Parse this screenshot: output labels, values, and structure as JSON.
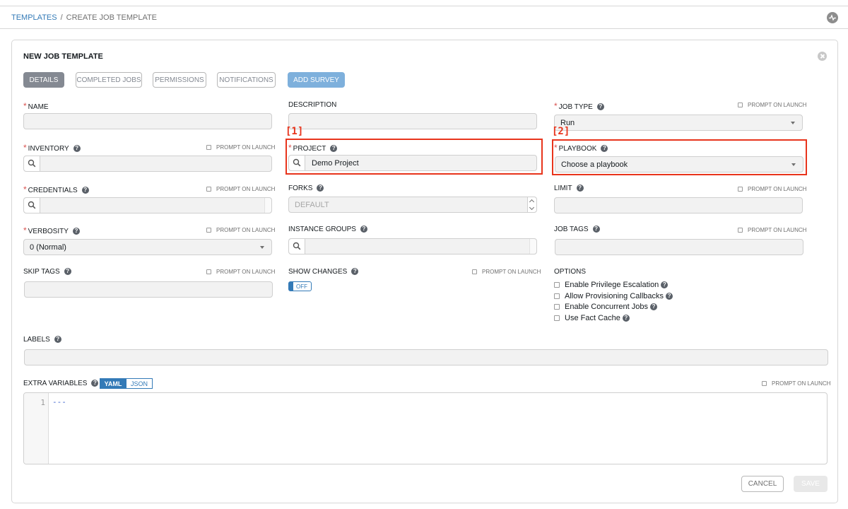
{
  "breadcrumb": {
    "parent": "TEMPLATES",
    "separator": "/",
    "current": "CREATE JOB TEMPLATE"
  },
  "panel": {
    "title": "NEW JOB TEMPLATE"
  },
  "tabs": [
    {
      "label": "DETAILS",
      "active": true
    },
    {
      "label": "COMPLETED JOBS",
      "active": false
    },
    {
      "label": "PERMISSIONS",
      "active": false
    },
    {
      "label": "NOTIFICATIONS",
      "active": false
    },
    {
      "label": "ADD SURVEY",
      "active": false
    }
  ],
  "common": {
    "prompt_on_launch": "PROMPT ON LAUNCH",
    "help_glyph": "?"
  },
  "fields": {
    "name": {
      "label": "NAME",
      "required": true,
      "value": ""
    },
    "description": {
      "label": "DESCRIPTION",
      "value": ""
    },
    "job_type": {
      "label": "JOB TYPE",
      "required": true,
      "value": "Run"
    },
    "inventory": {
      "label": "INVENTORY",
      "required": true,
      "value": ""
    },
    "project": {
      "label": "PROJECT",
      "required": true,
      "value": "Demo Project"
    },
    "playbook": {
      "label": "PLAYBOOK",
      "required": true,
      "value": "Choose a playbook"
    },
    "credentials": {
      "label": "CREDENTIALS",
      "required": true,
      "value": ""
    },
    "forks": {
      "label": "FORKS",
      "placeholder": "DEFAULT"
    },
    "limit": {
      "label": "LIMIT",
      "value": ""
    },
    "verbosity": {
      "label": "VERBOSITY",
      "required": true,
      "value": "0 (Normal)"
    },
    "instance_groups": {
      "label": "INSTANCE GROUPS",
      "value": ""
    },
    "job_tags": {
      "label": "JOB TAGS",
      "value": ""
    },
    "skip_tags": {
      "label": "SKIP TAGS",
      "value": ""
    },
    "show_changes": {
      "label": "SHOW CHANGES",
      "toggle": "OFF"
    },
    "options": {
      "label": "OPTIONS",
      "items": [
        "Enable Privilege Escalation",
        "Allow Provisioning Callbacks",
        "Enable Concurrent Jobs",
        "Use Fact Cache"
      ]
    },
    "labels": {
      "label": "LABELS",
      "value": ""
    },
    "extra_variables": {
      "label": "EXTRA VARIABLES",
      "modes": [
        "YAML",
        "JSON"
      ],
      "active_mode": "YAML",
      "line_number": "1",
      "content": "---"
    }
  },
  "annotations": {
    "marker1": "[1]",
    "marker2": "[2]",
    "color": "#e8341c"
  },
  "actions": {
    "cancel": "CANCEL",
    "save": "SAVE"
  },
  "colors": {
    "link": "#337ab7",
    "required": "#d9534f",
    "active_tab": "#848992",
    "survey_tab": "#7eb0dc"
  }
}
